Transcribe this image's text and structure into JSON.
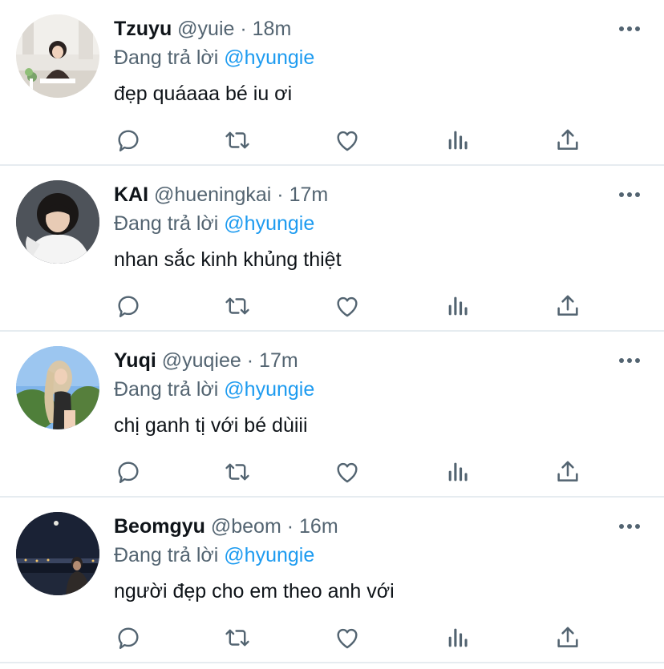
{
  "colors": {
    "mention": "#1d9bf0",
    "secondary_text": "#536471",
    "primary_text": "#0f1419",
    "icon": "#536471",
    "divider": "#e6ecf0"
  },
  "icons": [
    "reply-icon",
    "retweet-icon",
    "like-icon",
    "stats-icon",
    "share-icon",
    "more-icon"
  ],
  "tweets": [
    {
      "name": "Tzuyu",
      "handle": "@yuie",
      "separator": "·",
      "time": "18m",
      "reply_prefix": "Đang trả lời",
      "reply_to": "@hyungie",
      "text": "đẹp quáaaa bé iu ơi"
    },
    {
      "name": "KAI",
      "handle": "@hueningkai",
      "separator": "·",
      "time": "17m",
      "reply_prefix": "Đang trả lời",
      "reply_to": "@hyungie",
      "text": "nhan sắc kinh khủng thiệt"
    },
    {
      "name": "Yuqi",
      "handle": "@yuqiee",
      "separator": "·",
      "time": "17m",
      "reply_prefix": "Đang trả lời",
      "reply_to": "@hyungie",
      "text": "chị ganh tị với bé dùiii"
    },
    {
      "name": "Beomgyu",
      "handle": "@beom",
      "separator": "·",
      "time": "16m",
      "reply_prefix": "Đang trả lời",
      "reply_to": "@hyungie",
      "text": "người đẹp cho em theo anh với"
    }
  ]
}
